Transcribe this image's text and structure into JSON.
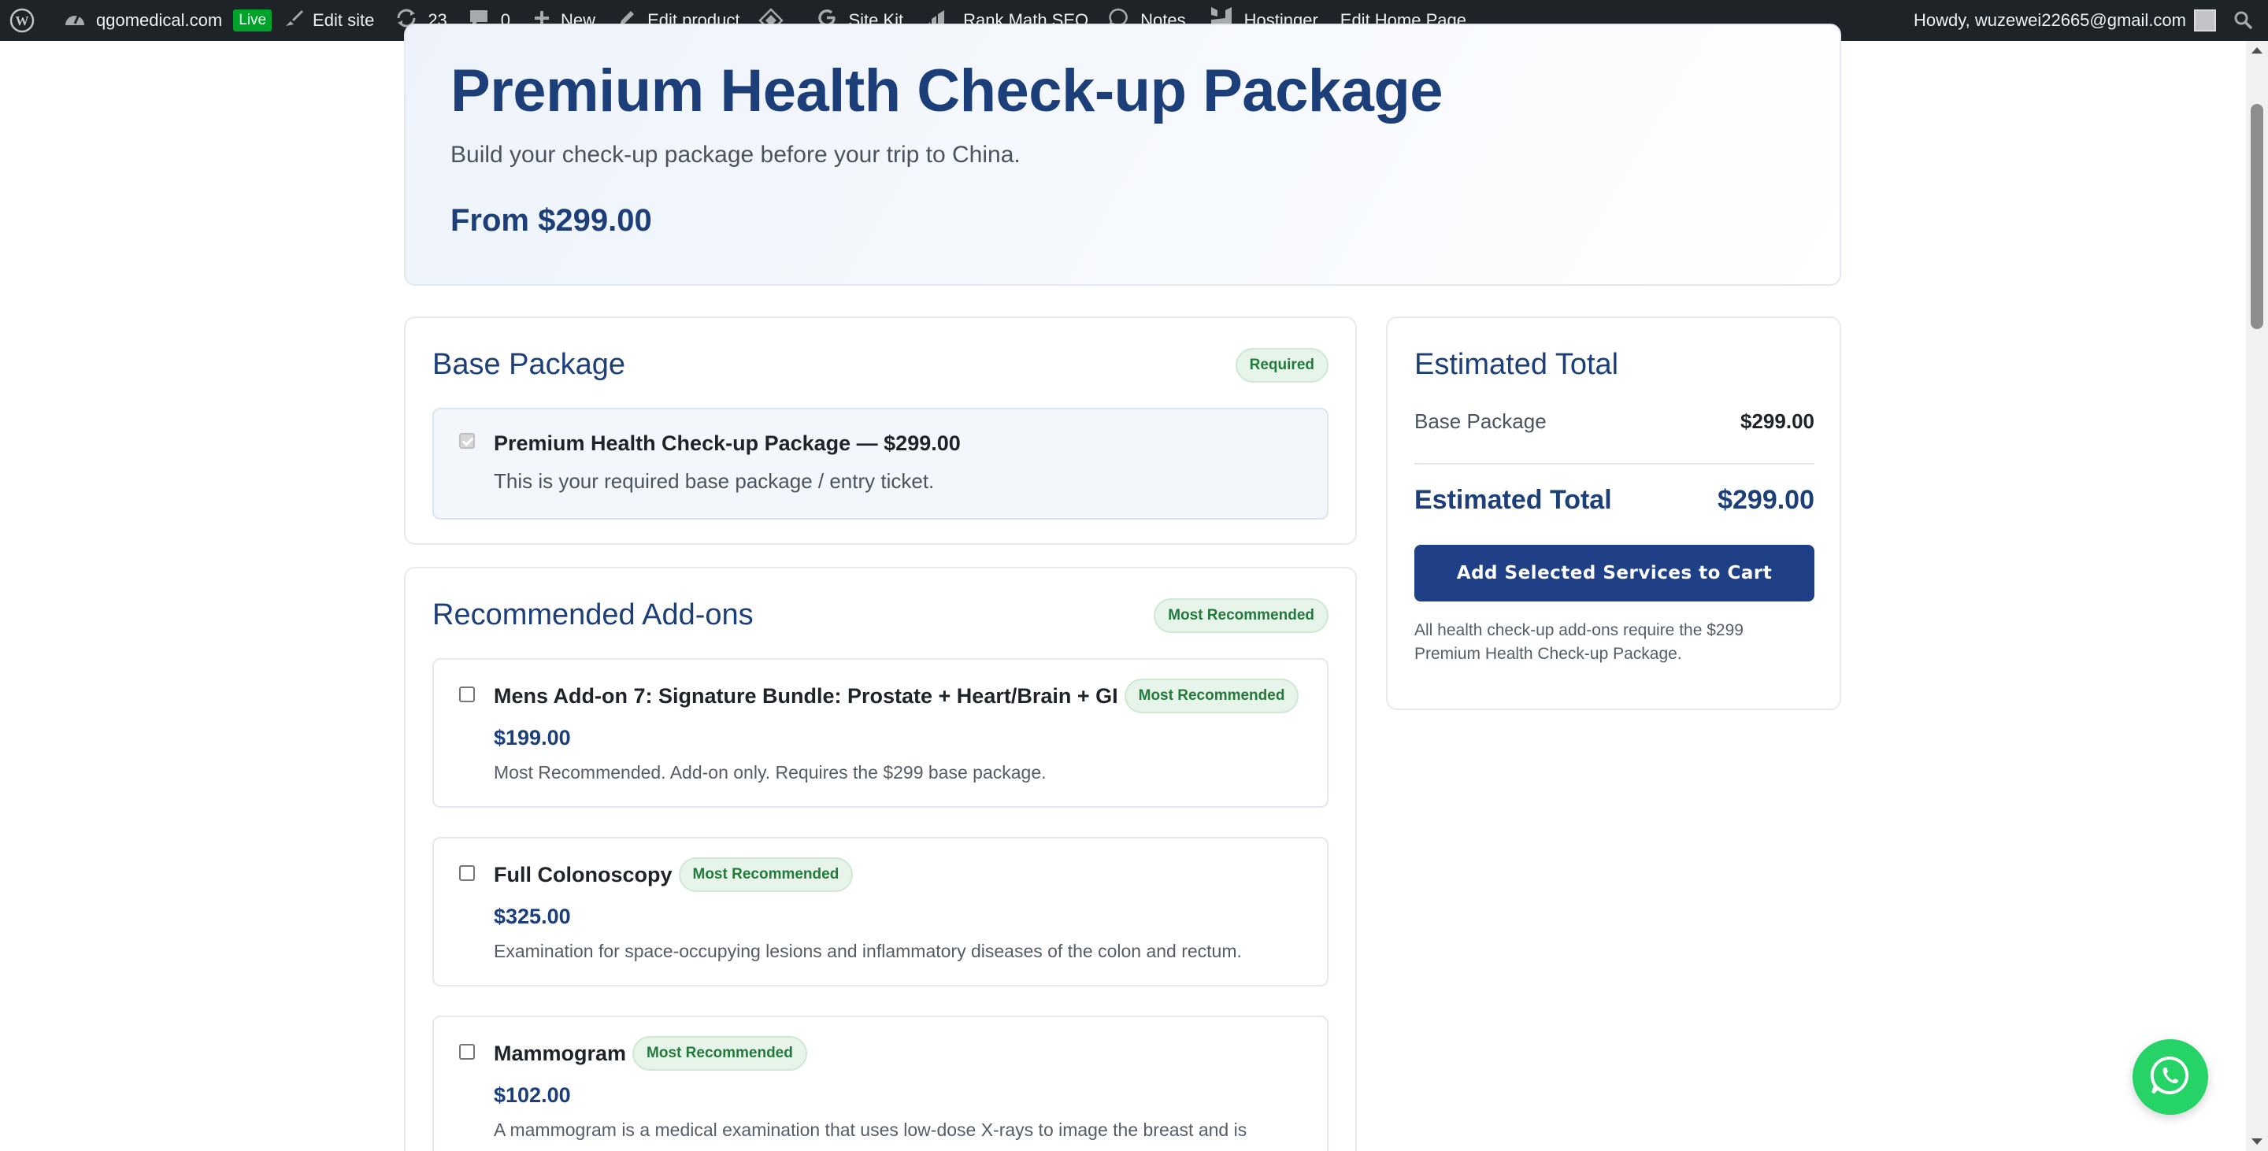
{
  "adminbar": {
    "wp_icon": "wordpress-logo-icon",
    "site_icon": "dashboard-icon",
    "site_name": "qgomedical.com",
    "live_badge": "Live",
    "edit_site_icon": "brush-icon",
    "edit_site": "Edit site",
    "updates_icon": "updates-icon",
    "updates_count": "23",
    "comments_icon": "comment-icon",
    "comments_count": "0",
    "new_icon": "plus-icon",
    "new_label": "New",
    "edit_product_icon": "pencil-icon",
    "edit_product": "Edit product",
    "diamond_icon": "diamond-icon",
    "site_kit_icon": "google-g-icon",
    "site_kit": "Site Kit",
    "rank_math_icon": "rank-math-icon",
    "rank_math": "Rank Math SEO",
    "notes_icon": "speech-bubble-icon",
    "notes": "Notes",
    "hostinger_icon": "hostinger-icon",
    "hostinger": "Hostinger",
    "edit_home": "Edit Home Page",
    "howdy": "Howdy, wuzewei22665@gmail.com",
    "search_icon": "search-icon"
  },
  "hero": {
    "title": "Premium Health Check-up Package",
    "subtitle": "Build your check-up package before your trip to China.",
    "price": "From $299.00"
  },
  "base": {
    "title": "Base Package",
    "badge": "Required",
    "item_title": "Premium Health Check-up Package — $299.00",
    "item_desc": "This is your required base package / entry ticket.",
    "checked": true
  },
  "addons": {
    "title": "Recommended Add-ons",
    "badge": "Most Recommended",
    "items": [
      {
        "name": "Mens Add-on 7: Signature Bundle: Prostate + Heart/Brain + GI",
        "badge": "Most Recommended",
        "price": "$199.00",
        "desc": "Most Recommended. Add-on only. Requires the $299 base package."
      },
      {
        "name": "Full Colonoscopy",
        "badge": "Most Recommended",
        "price": "$325.00",
        "desc": "Examination for space-occupying lesions and inflammatory diseases of the colon and rectum."
      },
      {
        "name": "Mammogram",
        "badge": "Most Recommended",
        "price": "$102.00",
        "desc": "A mammogram is a medical examination that uses low-dose X-rays to image the breast and is"
      }
    ]
  },
  "total": {
    "title": "Estimated Total",
    "base_label": "Base Package",
    "base_value": "$299.00",
    "total_label": "Estimated Total",
    "total_value": "$299.00",
    "button": "Add Selected Services to Cart",
    "note": "All health check-up add-ons require the $299 Premium Health Check-up Package."
  },
  "whatsapp": {
    "icon": "whatsapp-icon"
  },
  "colors": {
    "brand_navy": "#1c3f7a",
    "button_blue": "#1f3f86",
    "badge_green": "#237a3b",
    "badge_bg": "#e6f4ea",
    "admin_bar": "#1d2327",
    "live_green": "#00a32a",
    "whatsapp_green": "#25d366"
  }
}
